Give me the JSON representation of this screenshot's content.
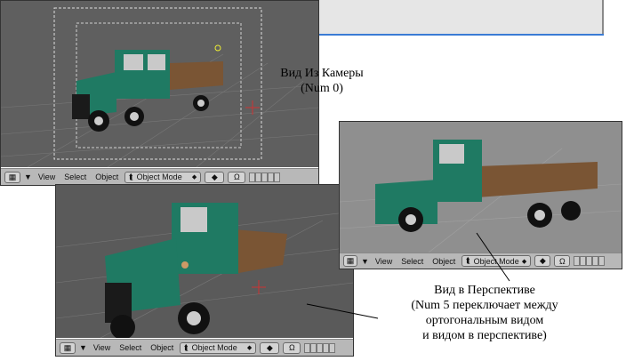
{
  "captions": {
    "camera_line1": "Вид Из Камеры",
    "camera_line2": "(Num 0)",
    "persp_line1": "Вид в Перспективе",
    "persp_line2": "(Num 5 переключает между",
    "persp_line3": "ортогональным видом",
    "persp_line4": "и видом в перспективе)"
  },
  "header": {
    "view": "View",
    "select": "Select",
    "object": "Object",
    "mode": "Object Mode"
  },
  "colors": {
    "viewport_bg": "#5a5a5a",
    "truck_body": "#1f7a63",
    "header_bg": "#b8b8b8"
  },
  "icons": [
    "grid-icon",
    "menu-triangle-icon",
    "object-mode-icon",
    "shading-sphere-icon",
    "pivot-icon",
    "layer-buttons"
  ]
}
